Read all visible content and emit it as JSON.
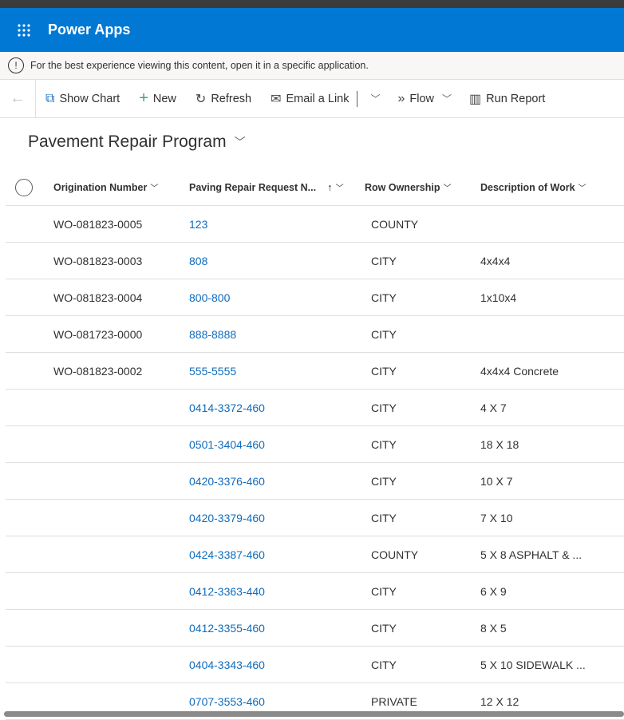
{
  "app": {
    "title": "Power Apps"
  },
  "notice": {
    "text": "For the best experience viewing this content, open it in a specific application."
  },
  "toolbar": {
    "show_chart": "Show Chart",
    "new": "New",
    "refresh": "Refresh",
    "email_link": "Email a Link",
    "flow": "Flow",
    "run_report": "Run Report"
  },
  "view": {
    "title": "Pavement Repair Program"
  },
  "columns": [
    "Origination Number",
    "Paving Repair Request N...",
    "Row Ownership",
    "Description of Work"
  ],
  "rows": [
    [
      "WO-081823-0005",
      "123",
      "COUNTY",
      ""
    ],
    [
      "WO-081823-0003",
      "808",
      "CITY",
      "4x4x4"
    ],
    [
      "WO-081823-0004",
      "800-800",
      "CITY",
      "1x10x4"
    ],
    [
      "WO-081723-0000",
      "888-8888",
      "CITY",
      ""
    ],
    [
      "WO-081823-0002",
      "555-5555",
      "CITY",
      "4x4x4 Concrete"
    ],
    [
      "",
      "0414-3372-460",
      "CITY",
      "4 X 7"
    ],
    [
      "",
      "0501-3404-460",
      "CITY",
      "18 X 18"
    ],
    [
      "",
      "0420-3376-460",
      "CITY",
      "10 X 7"
    ],
    [
      "",
      "0420-3379-460",
      "CITY",
      "7 X 10"
    ],
    [
      "",
      "0424-3387-460",
      "COUNTY",
      "5 X 8 ASPHALT & ..."
    ],
    [
      "",
      "0412-3363-440",
      "CITY",
      "6 X 9"
    ],
    [
      "",
      "0412-3355-460",
      "CITY",
      "8 X 5"
    ],
    [
      "",
      "0404-3343-460",
      "CITY",
      "5 X 10 SIDEWALK ..."
    ],
    [
      "",
      "0707-3553-460",
      "PRIVATE",
      "12 X 12"
    ]
  ],
  "colors": {
    "brand": "#0078d4",
    "link": "#0f6cbd"
  }
}
